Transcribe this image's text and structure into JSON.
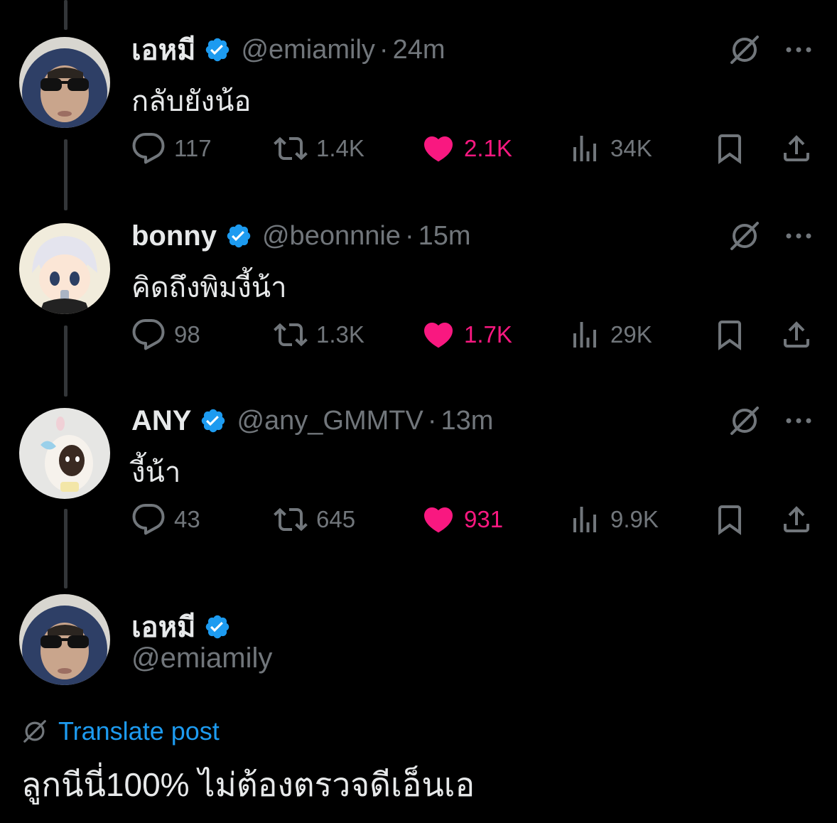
{
  "tweets": [
    {
      "display_name": "เอหมี",
      "handle": "@emiamily",
      "dot": "·",
      "time": "24m",
      "text": "กลับยังน้อ",
      "replies": "117",
      "retweets": "1.4K",
      "likes": "2.1K",
      "views": "34K",
      "avatar_icon": "sunglasses-hoodie-avatar"
    },
    {
      "display_name": "bonny",
      "handle": "@beonnnie",
      "dot": "·",
      "time": "15m",
      "text": "คิดถึงพิมงี้น้า",
      "replies": "98",
      "retweets": "1.3K",
      "likes": "1.7K",
      "views": "29K",
      "avatar_icon": "anime-boy-avatar"
    },
    {
      "display_name": "ANY",
      "handle": "@any_GMMTV",
      "dot": "·",
      "time": "13m",
      "text": "งี้น้า",
      "replies": "43",
      "retweets": "645",
      "likes": "931",
      "views": "9.9K",
      "avatar_icon": "plush-toy-avatar"
    }
  ],
  "main_tweet": {
    "display_name": "เอหมี",
    "handle": "@emiamily",
    "translate_label": "Translate post",
    "text": "ลูกนีนี่100% ไม่ต้องตรวจดีเอ็นเอ"
  },
  "colors": {
    "background": "#000000",
    "text": "#e7e9ea",
    "muted": "#71767b",
    "like": "#f91880",
    "verified": "#1d9bf0",
    "link": "#1d9bf0"
  },
  "icons": {
    "reply": "reply-icon",
    "retweet": "retweet-icon",
    "like": "heart-icon",
    "views": "views-icon",
    "bookmark": "bookmark-icon",
    "share": "share-icon",
    "grok": "grok-icon",
    "more": "more-icon",
    "verified": "verified-badge-icon"
  }
}
